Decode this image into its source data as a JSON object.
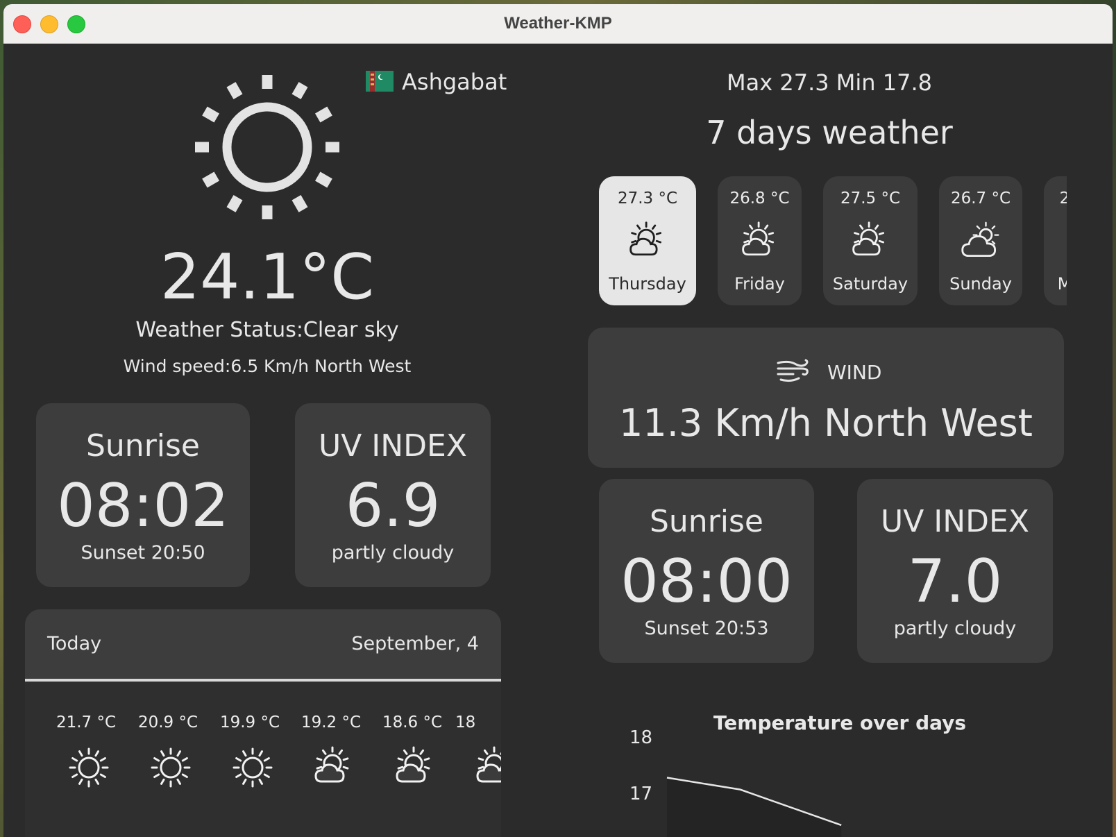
{
  "window": {
    "title": "Weather-KMP"
  },
  "current": {
    "city": "Ashgabat",
    "temperature": "24.1°C",
    "status": "Weather Status:Clear sky",
    "wind": "Wind speed:6.5 Km/h North West",
    "icon": "sun-icon",
    "sunrise_label": "Sunrise",
    "sunrise_time": "08:02",
    "sunset": "Sunset 20:50",
    "uv_label": "UV INDEX",
    "uv_value": "6.9",
    "uv_desc": "partly cloudy"
  },
  "today": {
    "label": "Today",
    "date": "September, 4",
    "hours": [
      {
        "temp": "21.7 °C",
        "icon": "sun-icon"
      },
      {
        "temp": "20.9 °C",
        "icon": "sun-icon"
      },
      {
        "temp": "19.9 °C",
        "icon": "sun-icon"
      },
      {
        "temp": "19.2 °C",
        "icon": "partly-cloudy-icon"
      },
      {
        "temp": "18.6 °C",
        "icon": "partly-cloudy-icon"
      },
      {
        "temp": "18",
        "icon": "partly-cloudy-icon"
      }
    ]
  },
  "forecast": {
    "maxmin": "Max 27.3 Min 17.8",
    "heading": "7 days weather",
    "days": [
      {
        "temp": "27.3 °C",
        "day": "Thursday",
        "icon": "partly-cloudy-icon",
        "selected": true
      },
      {
        "temp": "26.8 °C",
        "day": "Friday",
        "icon": "partly-cloudy-icon"
      },
      {
        "temp": "27.5 °C",
        "day": "Saturday",
        "icon": "partly-cloudy-icon"
      },
      {
        "temp": "26.7 °C",
        "day": "Sunday",
        "icon": "cloudy-sun-icon"
      },
      {
        "temp": "2",
        "day": "M",
        "icon": "partly-cloudy-icon"
      }
    ],
    "wind_label": "WIND",
    "wind_value": "11.3 Km/h North West",
    "sunrise_label": "Sunrise",
    "sunrise_time": "08:00",
    "sunset": "Sunset 20:53",
    "uv_label": "UV INDEX",
    "uv_value": "7.0",
    "uv_desc": "partly cloudy"
  },
  "chart_data": {
    "type": "area",
    "title": "Temperature over days",
    "y_ticks": [
      "18",
      "17"
    ],
    "points": [
      17.8,
      17.6,
      17.0
    ],
    "fill": "#242424",
    "line": "#e6e6e6"
  }
}
